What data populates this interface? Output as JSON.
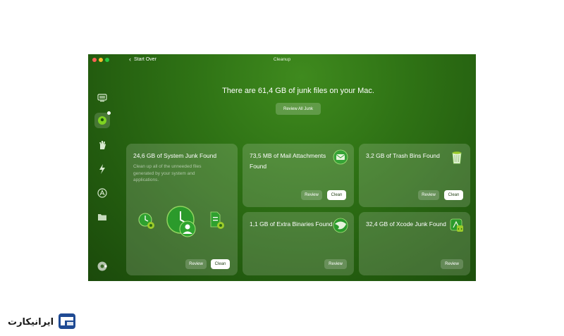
{
  "window": {
    "title": "Cleanup",
    "back_label": "Start Over"
  },
  "sidebar": {
    "items": [
      {
        "icon": "smart-scan-icon"
      },
      {
        "icon": "cleanup-icon",
        "active": true
      },
      {
        "icon": "protection-icon"
      },
      {
        "icon": "performance-icon"
      },
      {
        "icon": "applications-icon"
      },
      {
        "icon": "my-clutter-icon"
      }
    ],
    "bottom_icon": "assistant-icon"
  },
  "main": {
    "headline": "There are 61,4 GB of junk files on your Mac.",
    "review_all_label": "Review All Junk"
  },
  "cards": {
    "system_junk": {
      "title": "24,6 GB of System Junk Found",
      "description": "Clean up all of the unneeded files generated by your system and applications.",
      "review_label": "Review",
      "clean_label": "Clean"
    },
    "mail": {
      "title": "73,5 MB of Mail Attachments Found",
      "review_label": "Review",
      "clean_label": "Clean"
    },
    "trash": {
      "title": "3,2 GB of Trash Bins Found",
      "review_label": "Review",
      "clean_label": "Clean"
    },
    "binaries": {
      "title": "1,1 GB of Extra Binaries Found",
      "review_label": "Review"
    },
    "xcode": {
      "title": "32,4 GB of Xcode Junk Found",
      "review_label": "Review"
    }
  },
  "colors": {
    "window_bg": "#2f7315",
    "accent_green": "#4caf50",
    "traffic_red": "#ff5f57",
    "traffic_yellow": "#febc2e",
    "traffic_green": "#28c840"
  }
}
